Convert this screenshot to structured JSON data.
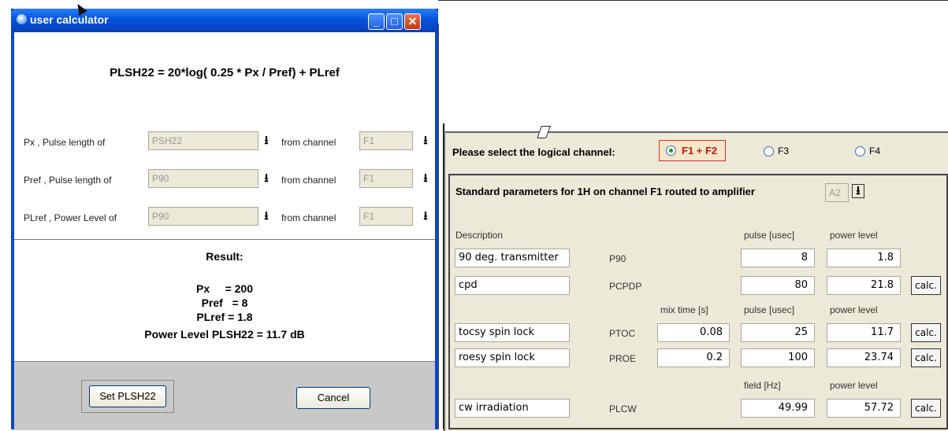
{
  "dialog": {
    "title": "user calculator",
    "window_controls": [
      "_",
      "□",
      "✕"
    ],
    "formula": "PLSH22 = 20*log( 0.25 *  Px / Pref) + PLref",
    "rows": [
      {
        "label": "Px ,  Pulse length of",
        "value": "PSH22",
        "channel_label": "from channel",
        "channel_value": "F1"
      },
      {
        "label": "Pref ,  Pulse length of",
        "value": "P90",
        "channel_label": "from channel",
        "channel_value": "F1"
      },
      {
        "label": "PLref , Power Level of",
        "value": "P90",
        "channel_label": "from channel",
        "channel_value": "F1"
      }
    ],
    "result_title": "Result:",
    "result_lines": [
      "Px     = 200",
      "Pref   = 8",
      "PLref = 1.8",
      "Power Level PLSH22 = 11.7 dB"
    ],
    "set_button": "Set PLSH22",
    "cancel_button": "Cancel"
  },
  "panel": {
    "select_label": "Please select the logical channel:",
    "channels": [
      {
        "label": "F1 + F2",
        "selected": true
      },
      {
        "label": "F3",
        "selected": false
      },
      {
        "label": "F4",
        "selected": false
      }
    ],
    "std_title": "Standard parameters for 1H on channel F1 routed to amplifier",
    "amplifier": "A2",
    "headers1": {
      "description": "Description",
      "pulse": "pulse [usec]",
      "power": "power level"
    },
    "rows1": [
      {
        "desc": "90 deg. transmitter",
        "param": "P90",
        "pulse": "8",
        "power": "1.8",
        "calc": ""
      },
      {
        "desc": "cpd",
        "param": "PCPDP",
        "pulse": "80",
        "power": "21.8",
        "calc": "calc."
      }
    ],
    "headers2": {
      "mix": "mix time [s]",
      "pulse": "pulse [usec]",
      "power": "power level"
    },
    "rows2": [
      {
        "desc": "tocsy spin lock",
        "param": "PTOC",
        "mix": "0.08",
        "pulse": "25",
        "power": "11.7",
        "calc": "calc."
      },
      {
        "desc": "roesy spin lock",
        "param": "PROE",
        "mix": "0.2",
        "pulse": "100",
        "power": "23.74",
        "calc": "calc."
      }
    ],
    "headers3": {
      "field": "field [Hz]",
      "power": "power level"
    },
    "rows3": [
      {
        "desc": "cw irradiation",
        "param": "PLCW",
        "field": "49.99",
        "power": "57.72",
        "calc": "calc."
      }
    ]
  },
  "colors": {
    "titlebar": "#0453dc",
    "dialog_bg": "#ece9d8",
    "radio_selected": "#1d9a1d",
    "selected_box_border": "#d23030"
  },
  "icons": [
    "app-icon",
    "download-arrow-icon",
    "mouse-cursor-icon"
  ]
}
